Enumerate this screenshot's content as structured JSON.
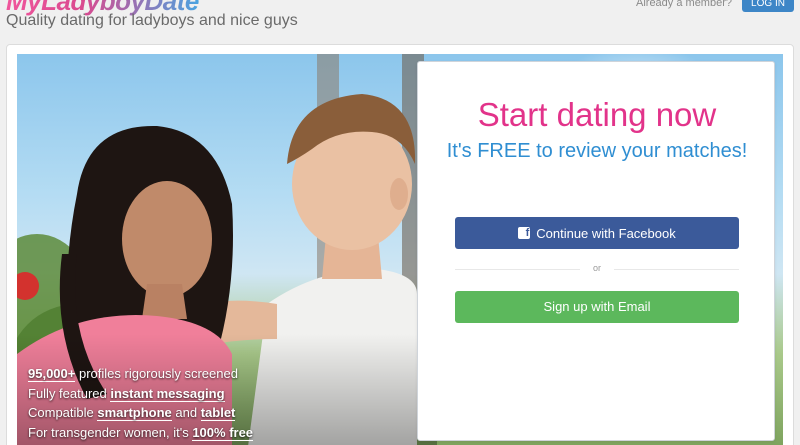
{
  "header": {
    "logo_text": "MyLadyboyDate",
    "tagline": "Quality dating for ladyboys and nice guys",
    "member_prompt": "Already a member?",
    "login_label": "LOG IN"
  },
  "hero": {
    "features": [
      {
        "strong": "95,000+",
        "text": " profiles rigorously screened"
      },
      {
        "text": "Fully featured ",
        "strong": "instant messaging"
      },
      {
        "text": "Compatible ",
        "strong": "smartphone",
        "text2": " and ",
        "strong2": "tablet"
      },
      {
        "text": "For transgender women, it's ",
        "strong": "100% free"
      }
    ]
  },
  "signup": {
    "title": "Start dating now",
    "subtitle": "It's FREE to review your matches!",
    "facebook_label": "Continue with Facebook",
    "facebook_icon": "f",
    "divider_text": "or",
    "email_label": "Sign up with Email"
  },
  "colors": {
    "brand_pink": "#e2338a",
    "brand_blue": "#2f8ed2",
    "facebook": "#3b5a9a",
    "email_green": "#5cb85c",
    "login_blue": "#3d86c7"
  }
}
